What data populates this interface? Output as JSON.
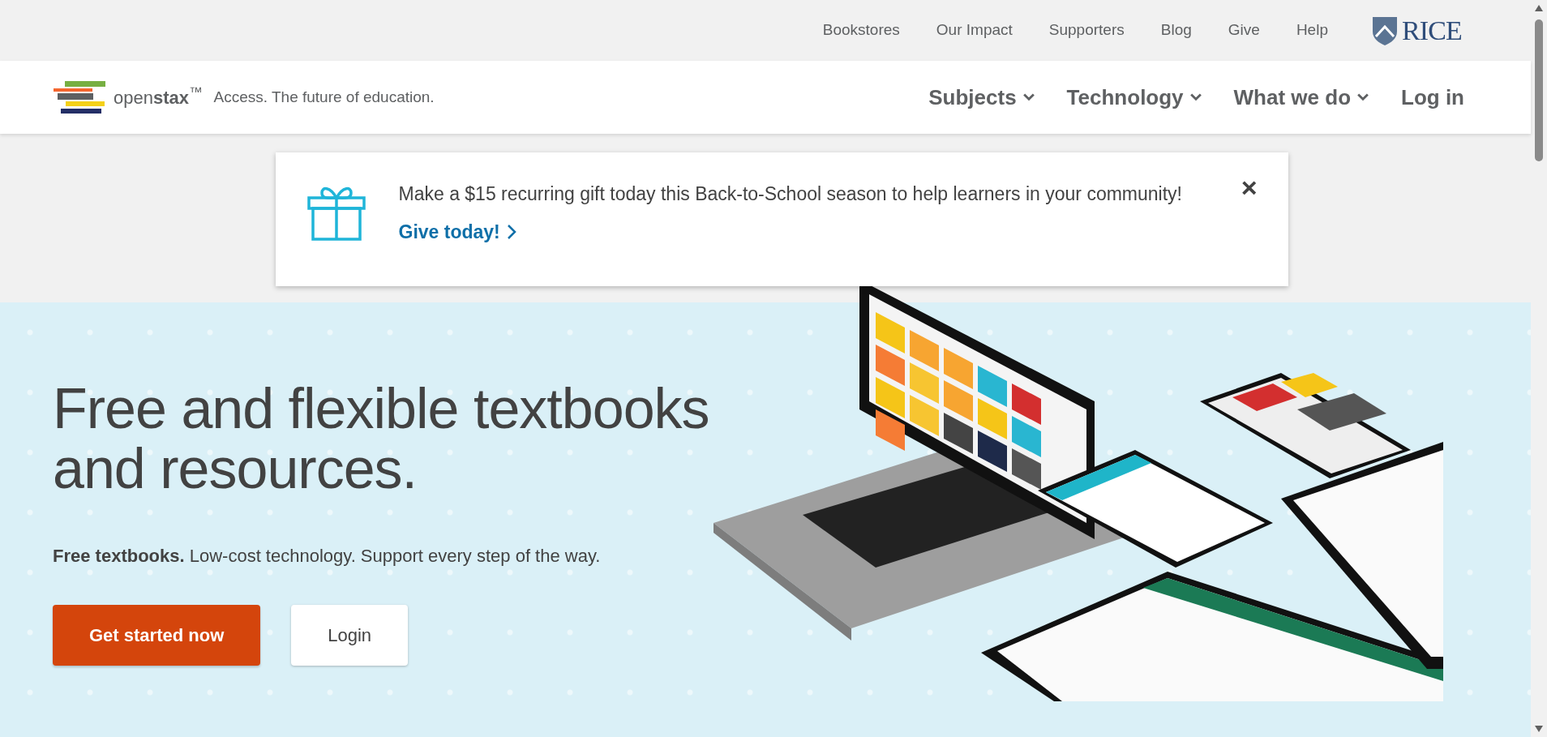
{
  "top_links": [
    "Bookstores",
    "Our Impact",
    "Supporters",
    "Blog",
    "Give",
    "Help"
  ],
  "partner_logo": {
    "text": "RICE"
  },
  "brand": {
    "name": "open**stax**$^{™}$",
    "tagline": "Access. The future of education."
  },
  "nav": [
    {
      "label": "Subjects",
      "kind": "menu"
    },
    {
      "label": "Technology",
      "kind": "menu"
    },
    {
      "label": "What we do",
      "kind": "menu"
    },
    {
      "label": "Log in",
      "kind": "link"
    }
  ],
  "banner": {
    "message": "Make a $15 recurring gift today this Back-to-School season to help learners in your community!",
    "link": "Give today!",
    "close": "×"
  },
  "hero": {
    "heading": "Free and flexible textbooks and resources.",
    "subheading": "**Free textbooks.** Low-cost technology. Support every step of the way.",
    "buttons": [
      {
        "label": "Get started now",
        "kind": "primary"
      },
      {
        "label": "Login",
        "kind": "secondary"
      }
    ]
  }
}
